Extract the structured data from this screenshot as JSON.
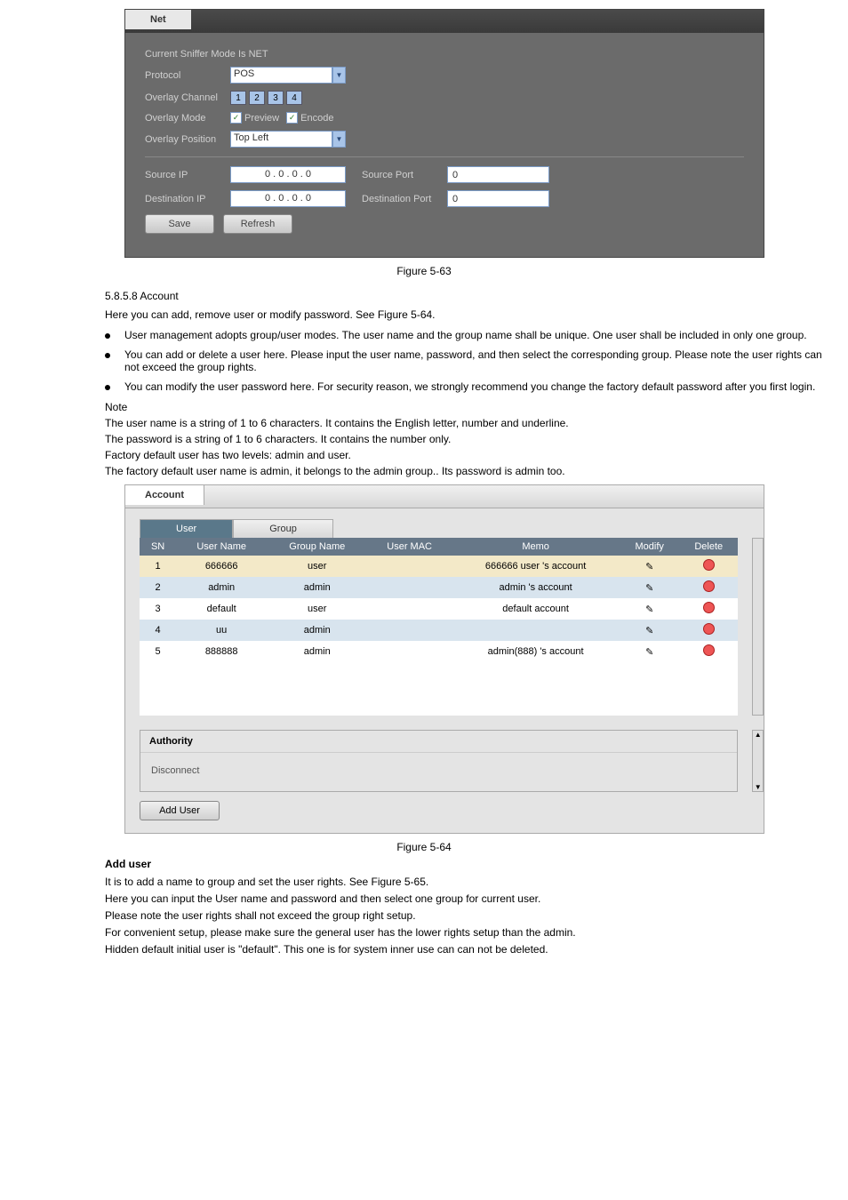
{
  "fig1": {
    "tab": "Net",
    "status": "Current Sniffer Mode Is NET",
    "protocolLbl": "Protocol",
    "protocolVal": "POS",
    "ovChLbl": "Overlay Channel",
    "ch": [
      "1",
      "2",
      "3",
      "4"
    ],
    "ovModeLbl": "Overlay Mode",
    "preview": "Preview",
    "encode": "Encode",
    "ovPosLbl": "Overlay Position",
    "ovPosVal": "Top Left",
    "srcIpLbl": "Source IP",
    "srcIp": "0   .   0   .   0   .   0",
    "srcPortLbl": "Source Port",
    "srcPort": "0",
    "dstIpLbl": "Destination IP",
    "dstIp": "0   .   0   .   0   .   0",
    "dstPortLbl": "Destination Port",
    "dstPort": "0",
    "save": "Save",
    "refresh": "Refresh"
  },
  "caption1": "Figure 5-63",
  "heading": "5.8.5.8 Account",
  "intro": "Here you can add, remove user or modify password. See Figure 5-64.",
  "bullets": [
    "User management adopts group/user modes. The user name and the group name shall be unique. One user shall be included in only one group.",
    "You can add or delete a user here. Please input the user name, password, and then select the corresponding group. Please note the user rights can not exceed the group rights.",
    "You can modify the user password here. For security reason, we strongly recommend you change the factory default password after you first login."
  ],
  "note1": "Note",
  "notes": [
    "The user name  is a string of 1 to 6 characters. It contains the English letter, number and underline.",
    "The password is a string of 1 to 6 characters. It contains the number only.",
    "Factory default user has two levels: admin and user.",
    "The factory default user name is admin, it belongs to the admin group.. Its password is admin too."
  ],
  "fig2": {
    "tab": "Account",
    "userTab": "User",
    "groupTab": "Group",
    "cols": [
      "SN",
      "User Name",
      "Group Name",
      "User MAC",
      "Memo",
      "Modify",
      "Delete"
    ],
    "rows": [
      {
        "sn": "1",
        "un": "666666",
        "gn": "user",
        "mac": "",
        "memo": "666666 user 's account"
      },
      {
        "sn": "2",
        "un": "admin",
        "gn": "admin",
        "mac": "",
        "memo": "admin 's account"
      },
      {
        "sn": "3",
        "un": "default",
        "gn": "user",
        "mac": "",
        "memo": "default account"
      },
      {
        "sn": "4",
        "un": "uu",
        "gn": "admin",
        "mac": "",
        "memo": ""
      },
      {
        "sn": "5",
        "un": "888888",
        "gn": "admin",
        "mac": "",
        "memo": "admin(888) 's account"
      }
    ],
    "authority": "Authority",
    "disconnect": "Disconnect",
    "addUser": "Add User"
  },
  "caption2": "Figure 5-64",
  "addUser": {
    "h": "Add user",
    "t": "It is to add a name to group and set the user rights. See Figure 5-65.",
    "t2": "Here you can input the User name and password and then select one group for current user.",
    "t3": "Please note the user rights shall not exceed the group right setup.",
    "t4": "For convenient setup, please make sure the general user has the lower rights setup than the admin.",
    "t5": "Hidden default initial user is \"default\". This one is for system inner use can can not be deleted."
  }
}
